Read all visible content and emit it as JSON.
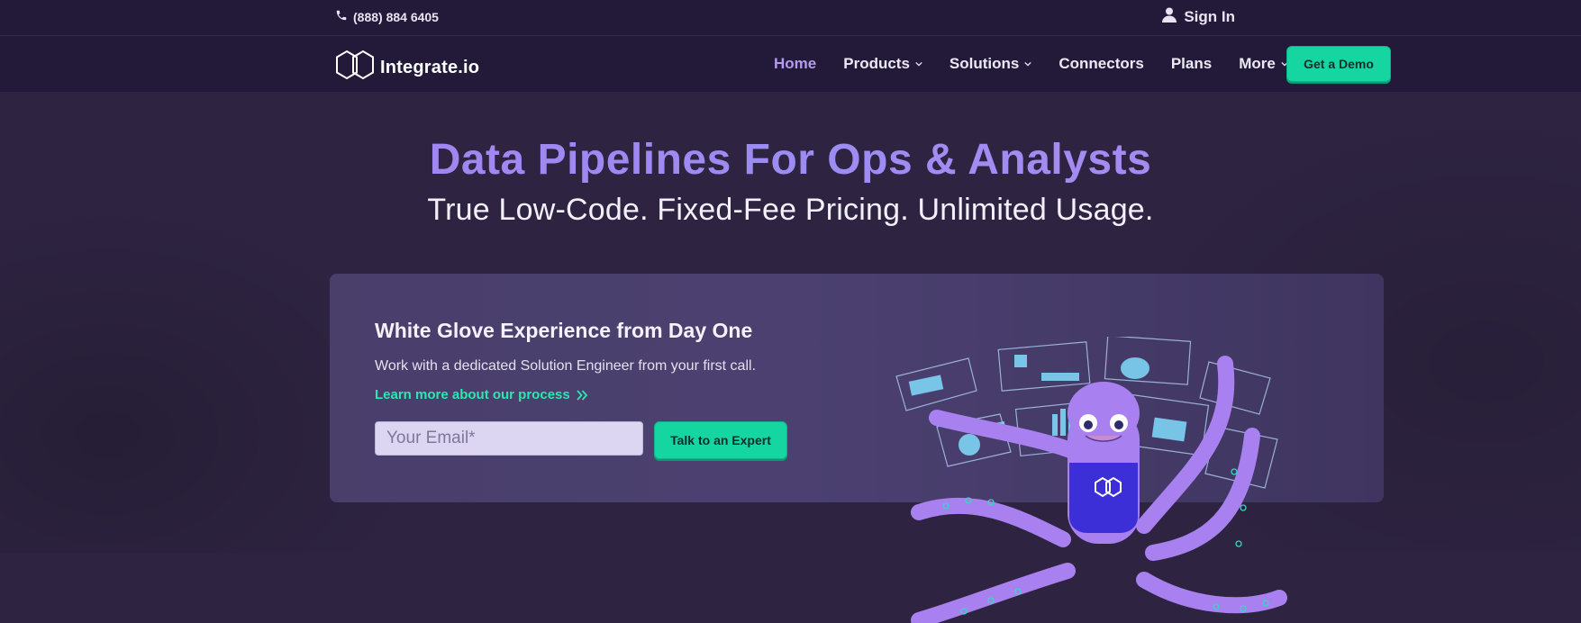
{
  "topbar": {
    "phone": "(888) 884 6405",
    "sign_in": "Sign In"
  },
  "brand": {
    "name": "Integrate.io"
  },
  "nav": {
    "items": [
      {
        "label": "Home",
        "active": true,
        "dropdown": false
      },
      {
        "label": "Products",
        "active": false,
        "dropdown": true
      },
      {
        "label": "Solutions",
        "active": false,
        "dropdown": true
      },
      {
        "label": "Connectors",
        "active": false,
        "dropdown": false
      },
      {
        "label": "Plans",
        "active": false,
        "dropdown": false
      },
      {
        "label": "More",
        "active": false,
        "dropdown": true
      }
    ],
    "cta": "Get a Demo"
  },
  "hero": {
    "title": "Data Pipelines For Ops & Analysts",
    "subtitle": "True Low-Code. Fixed-Fee Pricing. Unlimited Usage."
  },
  "card": {
    "title": "White Glove Experience from Day One",
    "description": "Work with a dedicated Solution Engineer from your first call.",
    "link": "Learn more about our process",
    "email_placeholder": "Your Email*",
    "button": "Talk to an Expert"
  },
  "colors": {
    "accent_green": "#15d6a0",
    "active_nav": "#b49af0",
    "background": "#2e2442",
    "navbar": "#221a38"
  }
}
